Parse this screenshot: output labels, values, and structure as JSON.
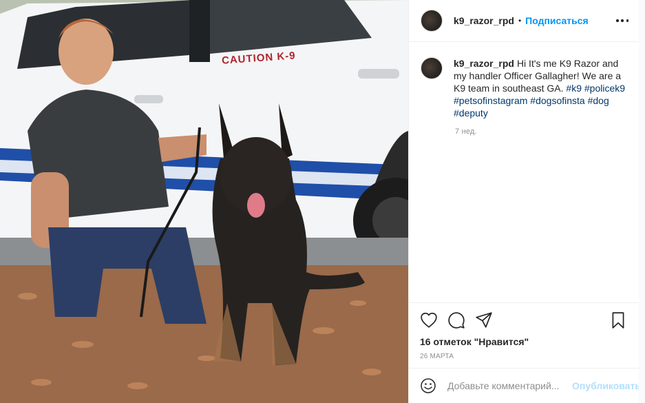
{
  "post": {
    "photo_text": "CAUTION K-9"
  },
  "header": {
    "username": "k9_razor_rpd",
    "separator": "•",
    "follow_label": "Подписаться"
  },
  "caption": {
    "username": "k9_razor_rpd",
    "text": "Hi It's me K9 Razor and my handler Officer Gallagher! We are a K9 team in southeast GA.",
    "hashtags": [
      "#k9",
      "#policek9",
      "#petsofinstagram",
      "#dogsofinsta",
      "#dog",
      "#deputy"
    ],
    "time": "7 нед."
  },
  "actions": {
    "like_icon": "heart-icon",
    "comment_icon": "comment-icon",
    "share_icon": "share-icon",
    "save_icon": "bookmark-icon",
    "likes_text": "16 отметок \"Нравится\"",
    "date": "26 марта"
  },
  "comment_box": {
    "placeholder": "Добавьте комментарий...",
    "publish_label": "Опубликовать",
    "emoji_icon": "smiley-icon"
  },
  "colors": {
    "accent": "#0095f6",
    "hashtag": "#00376b",
    "muted": "#8e8e8e",
    "publish_disabled": "#b2dffc"
  }
}
